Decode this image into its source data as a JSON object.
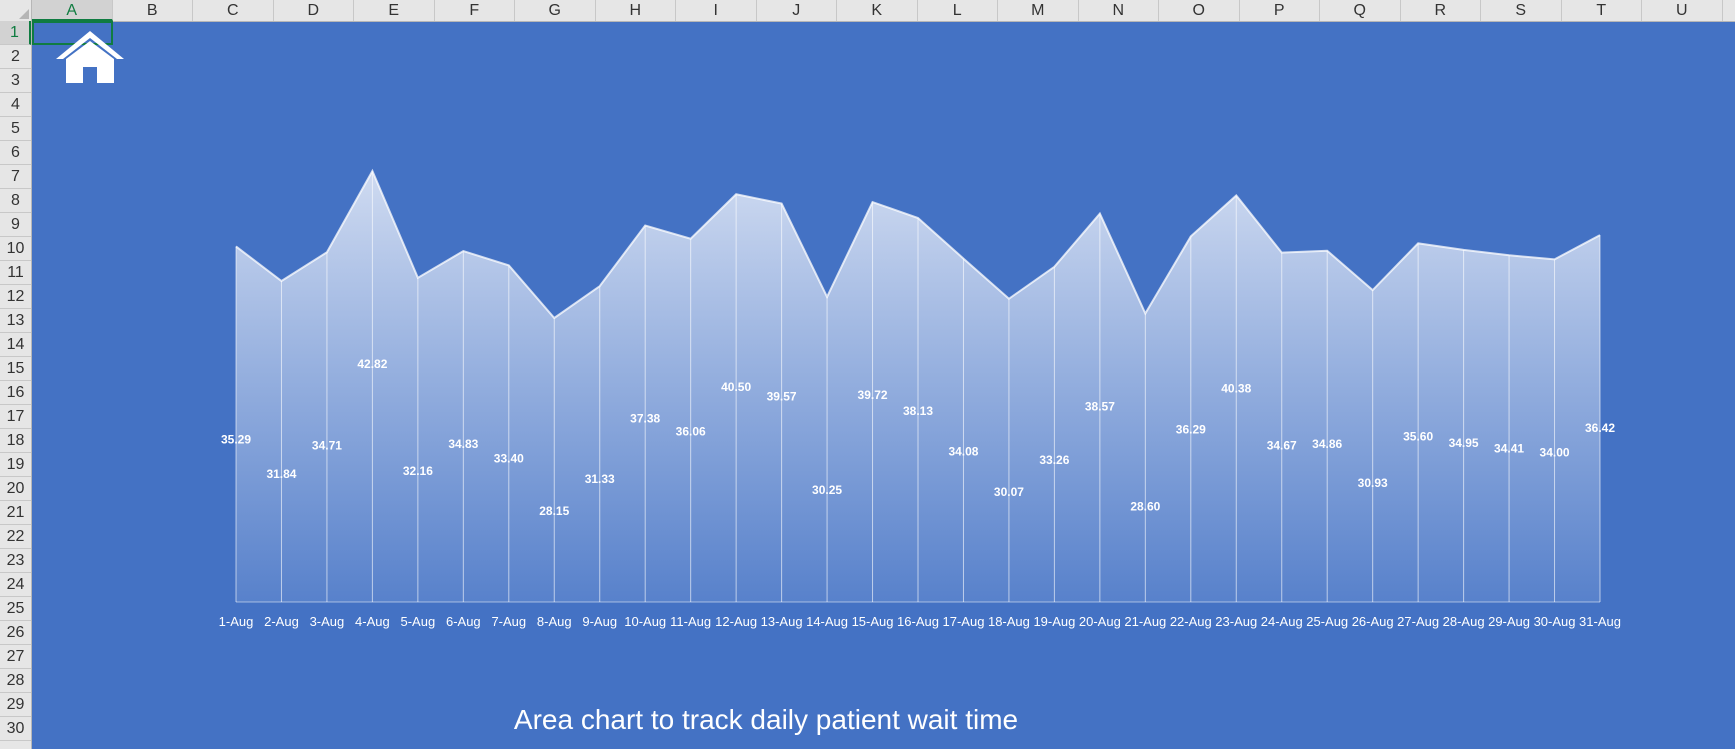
{
  "sheet": {
    "columns": [
      "A",
      "B",
      "C",
      "D",
      "E",
      "F",
      "G",
      "H",
      "I",
      "J",
      "K",
      "L",
      "M",
      "N",
      "O",
      "P",
      "Q",
      "R",
      "S",
      "T",
      "U"
    ],
    "rows": [
      "1",
      "2",
      "3",
      "4",
      "5",
      "6",
      "7",
      "8",
      "9",
      "10",
      "11",
      "12",
      "13",
      "14",
      "15",
      "16",
      "17",
      "18",
      "19",
      "20",
      "21",
      "22",
      "23",
      "24",
      "25",
      "26",
      "27",
      "28",
      "29",
      "30"
    ],
    "selected_column": "A",
    "selected_row": "1"
  },
  "icons": {
    "home": "home-icon"
  },
  "colors": {
    "background": "#4472c4",
    "area_top": "#d6e0f3",
    "area_bottom": "#5a83cc",
    "line": "#ffffff",
    "text": "#ffffff"
  },
  "chart_data": {
    "type": "area",
    "title": "Area chart to track daily patient wait time",
    "xlabel": "",
    "ylabel": "",
    "grid": false,
    "legend": "none",
    "categories": [
      "1-Aug",
      "2-Aug",
      "3-Aug",
      "4-Aug",
      "5-Aug",
      "6-Aug",
      "7-Aug",
      "8-Aug",
      "9-Aug",
      "10-Aug",
      "11-Aug",
      "12-Aug",
      "13-Aug",
      "14-Aug",
      "15-Aug",
      "16-Aug",
      "17-Aug",
      "18-Aug",
      "19-Aug",
      "20-Aug",
      "21-Aug",
      "22-Aug",
      "23-Aug",
      "24-Aug",
      "25-Aug",
      "26-Aug",
      "27-Aug",
      "28-Aug",
      "29-Aug",
      "30-Aug",
      "31-Aug"
    ],
    "values": [
      35.29,
      31.84,
      34.71,
      42.82,
      32.16,
      34.83,
      33.4,
      28.15,
      31.33,
      37.38,
      36.06,
      40.5,
      39.57,
      30.25,
      39.72,
      38.13,
      34.08,
      30.07,
      33.26,
      38.57,
      28.6,
      36.29,
      40.38,
      34.67,
      34.86,
      30.93,
      35.6,
      34.95,
      34.41,
      34.0,
      36.42
    ],
    "ylim": [
      0,
      45
    ]
  }
}
